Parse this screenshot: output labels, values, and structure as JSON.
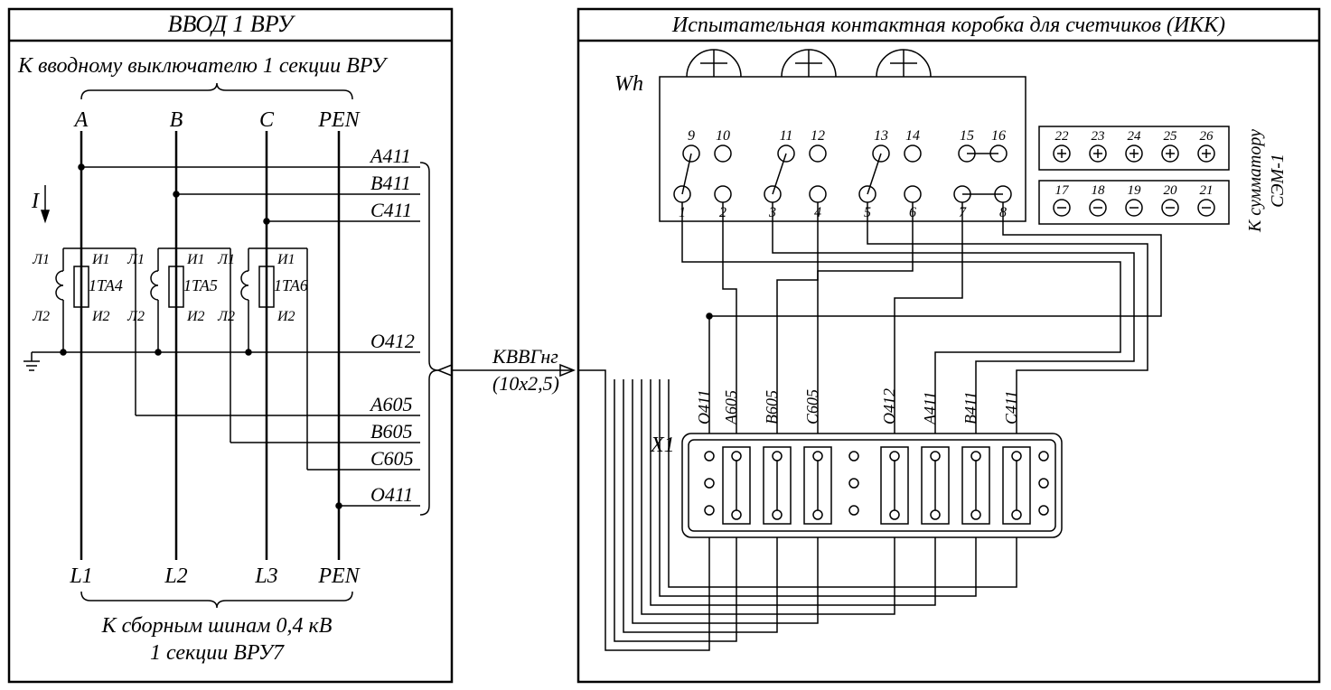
{
  "left": {
    "title": "ВВОД 1 ВРУ",
    "top_caption": "К вводному выключателю 1 секции ВРУ",
    "phases": {
      "a": "A",
      "b": "B",
      "c": "C",
      "pen": "PEN"
    },
    "bus_bottom": {
      "l1": "L1",
      "l2": "L2",
      "l3": "L3",
      "pen": "PEN"
    },
    "wires": {
      "a411": "А411",
      "b411": "В411",
      "c411": "С411",
      "o412": "О412",
      "a605": "А605",
      "b605": "В605",
      "c605": "С605",
      "o411": "О411"
    },
    "ct": {
      "ta4": "1ТА4",
      "ta5": "1ТА5",
      "ta6": "1ТА6",
      "l1": "Л1",
      "l2": "Л2",
      "u1": "И1",
      "u2": "И2"
    },
    "i": "I",
    "bottom_caption1": "К сборным шинам 0,4 кВ",
    "bottom_caption2": "1 секции ВРУ7"
  },
  "cable": {
    "type": "КВВГнг",
    "size": "(10x2,5)"
  },
  "right": {
    "title": "Испытательная контактная коробка для счетчиков (ИКК)",
    "wh": "Wh",
    "x1": "X1",
    "summator": "К сумматору",
    "sem": "СЭМ-1",
    "meter_terms": {
      "1": "1",
      "2": "2",
      "3": "3",
      "4": "4",
      "5": "5",
      "6": "6",
      "7": "7",
      "8": "8",
      "9": "9",
      "10": "10",
      "11": "11",
      "12": "12",
      "13": "13",
      "14": "14",
      "15": "15",
      "16": "16"
    },
    "plus": {
      "22": "22",
      "23": "23",
      "24": "24",
      "25": "25",
      "26": "26"
    },
    "minus": {
      "17": "17",
      "18": "18",
      "19": "19",
      "20": "20",
      "21": "21"
    },
    "x1_labels": {
      "o411": "О411",
      "a605": "А605",
      "b605": "В605",
      "c605": "С605",
      "o412": "О412",
      "a411": "А411",
      "b411": "В411",
      "c411": "С411"
    }
  }
}
